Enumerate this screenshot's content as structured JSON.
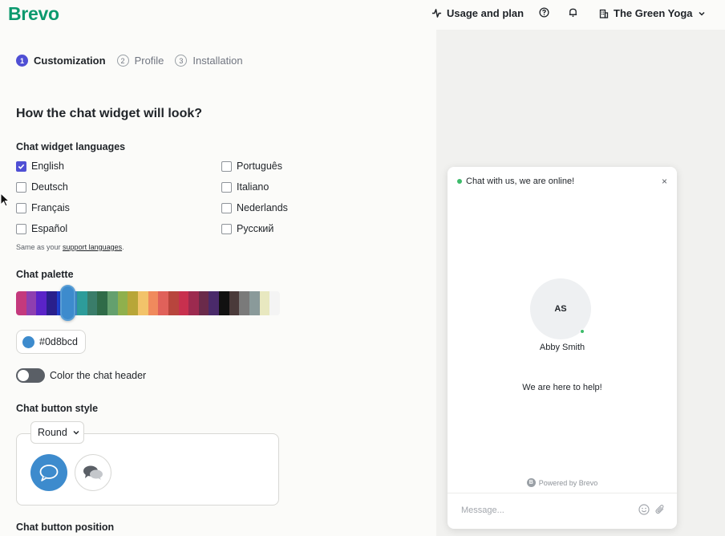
{
  "header": {
    "logo": "Brevo",
    "usage_label": "Usage and plan",
    "account_label": "The Green Yoga"
  },
  "steps": [
    {
      "num": "1",
      "label": "Customization"
    },
    {
      "num": "2",
      "label": "Profile"
    },
    {
      "num": "3",
      "label": "Installation"
    }
  ],
  "main": {
    "title": "How the chat widget will look?",
    "languages_label": "Chat widget languages",
    "languages": [
      {
        "label": "English",
        "checked": true
      },
      {
        "label": "Deutsch",
        "checked": false
      },
      {
        "label": "Français",
        "checked": false
      },
      {
        "label": "Español",
        "checked": false
      },
      {
        "label": "Português",
        "checked": false
      },
      {
        "label": "Italiano",
        "checked": false
      },
      {
        "label": "Nederlands",
        "checked": false
      },
      {
        "label": "Русский",
        "checked": false
      }
    ],
    "hint_prefix": "Same as your",
    "hint_link": "support languages",
    "hint_suffix": ".",
    "palette_label": "Chat palette",
    "palette_colors": [
      "#c4397d",
      "#8e3fb0",
      "#5a23c8",
      "#2a1f8c",
      "#1e3fd0",
      "#3d8bcd",
      "#2d9c9a",
      "#3a7d6a",
      "#2f6b48",
      "#64a06e",
      "#8fb04d",
      "#b8a638",
      "#f2c36a",
      "#f08a5d",
      "#e0615a",
      "#b8453d",
      "#c8304e",
      "#9c2a4f",
      "#6a2a4a",
      "#4a2a6a",
      "#111111",
      "#4a3a3a",
      "#7a7a7a",
      "#8a9a9a",
      "#e8e8c0",
      "#f4f4f4"
    ],
    "selected_color": "#0d8bcd",
    "color_header_label": "Color the chat header",
    "button_style_label": "Chat button style",
    "button_style_value": "Round",
    "button_position_label": "Chat button position"
  },
  "widget": {
    "status_text": "Chat with us, we are online!",
    "close_glyph": "×",
    "avatar_initials": "AS",
    "agent_name": "Abby Smith",
    "help_text": "We are here to help!",
    "powered_by": "Powered by Brevo",
    "powered_badge": "B",
    "input_placeholder": "Message..."
  },
  "colors": {
    "accent": "#4f4fd4",
    "brand": "#0b996e",
    "chat": "#3d8bcd"
  }
}
